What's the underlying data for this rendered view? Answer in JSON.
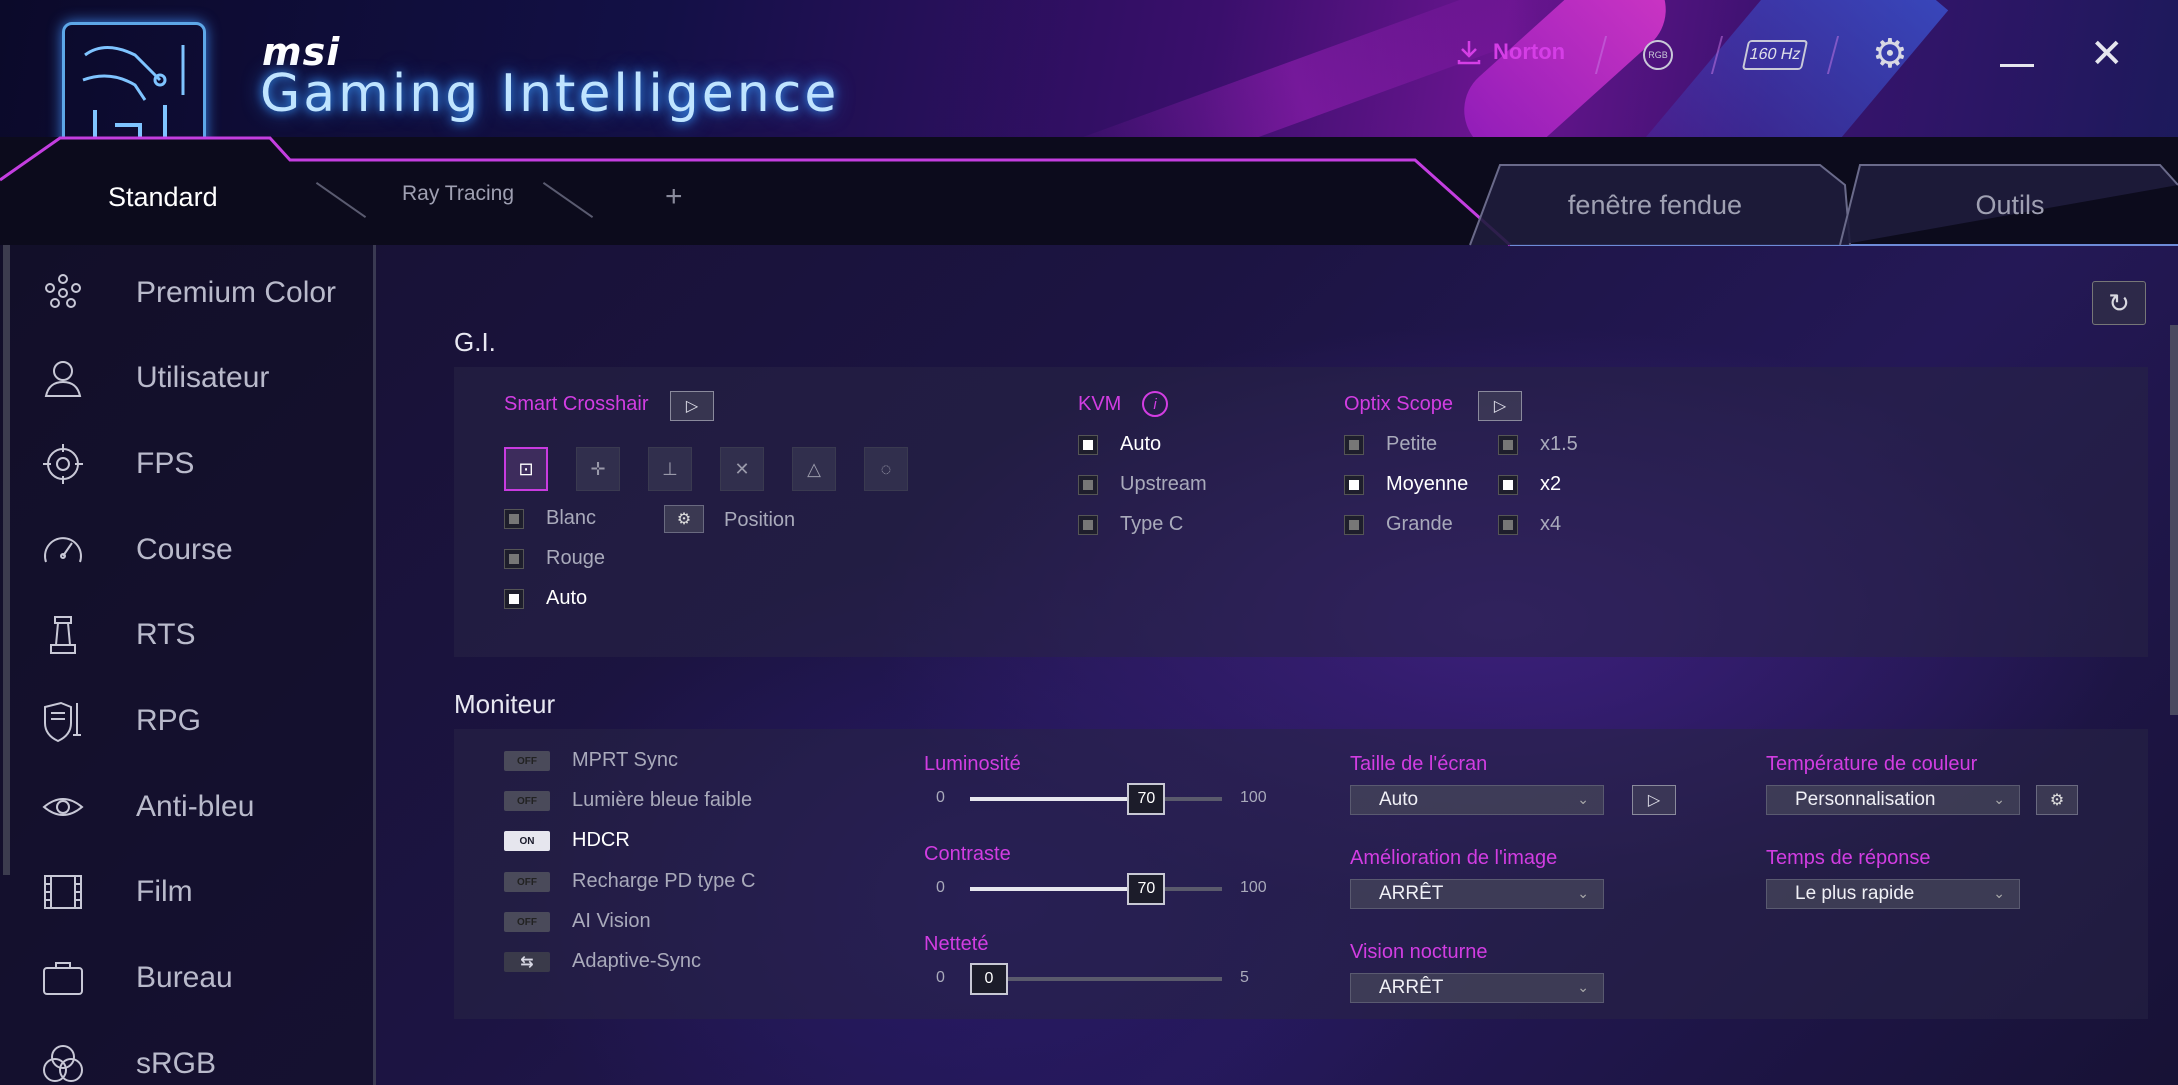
{
  "header": {
    "brand": "msi",
    "app_title": "Gaming Intelligence",
    "norton_label": "Norton",
    "rgb_label": "RGB",
    "hz_label": "160 Hz"
  },
  "tabs": {
    "left": [
      {
        "label": "Standard",
        "active": true
      },
      {
        "label": "Ray Tracing",
        "active": false
      }
    ],
    "add_label": "+",
    "right": [
      {
        "label": "fenêtre fendue"
      },
      {
        "label": "Outils"
      }
    ]
  },
  "sidebar": {
    "items": [
      {
        "label": "Premium Color",
        "icon": "premium-color-icon"
      },
      {
        "label": "Utilisateur",
        "icon": "user-icon"
      },
      {
        "label": "FPS",
        "icon": "crosshair-icon"
      },
      {
        "label": "Course",
        "icon": "speedometer-icon"
      },
      {
        "label": "RTS",
        "icon": "chess-tower-icon"
      },
      {
        "label": "RPG",
        "icon": "shield-sword-icon"
      },
      {
        "label": "Anti-bleu",
        "icon": "eye-icon"
      },
      {
        "label": "Film",
        "icon": "film-icon"
      },
      {
        "label": "Bureau",
        "icon": "briefcase-icon"
      },
      {
        "label": "sRGB",
        "icon": "srgb-icon"
      }
    ]
  },
  "gi": {
    "title": "G.I.",
    "smart_crosshair": {
      "title": "Smart Crosshair",
      "colors": [
        {
          "label": "Blanc",
          "checked": false
        },
        {
          "label": "Rouge",
          "checked": false
        },
        {
          "label": "Auto",
          "checked": true
        }
      ],
      "position_label": "Position"
    },
    "kvm": {
      "title": "KVM",
      "options": [
        {
          "label": "Auto",
          "checked": true
        },
        {
          "label": "Upstream",
          "checked": false
        },
        {
          "label": "Type C",
          "checked": false
        }
      ]
    },
    "optix_scope": {
      "title": "Optix Scope",
      "sizes": [
        {
          "label": "Petite",
          "checked": false
        },
        {
          "label": "Moyenne",
          "checked": true
        },
        {
          "label": "Grande",
          "checked": false
        }
      ],
      "zooms": [
        {
          "label": "x1.5",
          "checked": false
        },
        {
          "label": "x2",
          "checked": true
        },
        {
          "label": "x4",
          "checked": false
        }
      ]
    }
  },
  "monitor": {
    "title": "Moniteur",
    "toggles": [
      {
        "label": "MPRT Sync",
        "state": "OFF",
        "on": false
      },
      {
        "label": "Lumière bleue faible",
        "state": "OFF",
        "on": false
      },
      {
        "label": "HDCR",
        "state": "ON",
        "on": true
      },
      {
        "label": "Recharge PD type C",
        "state": "OFF",
        "on": false
      },
      {
        "label": "AI Vision",
        "state": "OFF",
        "on": false
      },
      {
        "label": "Adaptive-Sync",
        "state": "⇆",
        "on": false
      }
    ],
    "brightness": {
      "label": "Luminosité",
      "min": "0",
      "max": "100",
      "value": "70",
      "fraction": 0.7
    },
    "contrast": {
      "label": "Contraste",
      "min": "0",
      "max": "100",
      "value": "70",
      "fraction": 0.7
    },
    "sharpness": {
      "label": "Netteté",
      "min": "0",
      "max": "5",
      "value": "0",
      "fraction": 0.0
    },
    "screen_size": {
      "label": "Taille de l'écran",
      "value": "Auto"
    },
    "image_enhancement": {
      "label": "Amélioration de l'image",
      "value": "ARRÊT"
    },
    "night_vision": {
      "label": "Vision nocturne",
      "value": "ARRÊT"
    },
    "color_temperature": {
      "label": "Température de couleur",
      "value": "Personnalisation"
    },
    "response_time": {
      "label": "Temps de réponse",
      "value": "Le plus rapide"
    }
  },
  "colors": {
    "accent": "#d23de2",
    "active_text": "#ffffff",
    "muted_text": "#a9aabb"
  }
}
